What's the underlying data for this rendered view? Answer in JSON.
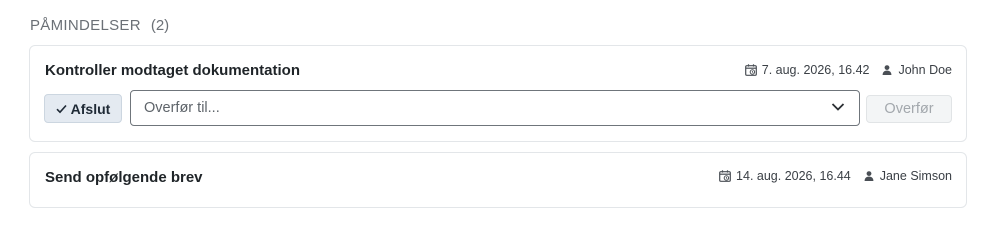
{
  "section": {
    "title": "PÅMINDELSER",
    "count": "(2)"
  },
  "reminders": [
    {
      "title": "Kontroller modtaget dokumentation",
      "datetime": "7. aug. 2026, 16.42",
      "user": "John Doe",
      "complete_label": "Afslut",
      "transfer_placeholder": "Overfør til...",
      "transfer_label": "Overfør"
    },
    {
      "title": "Send opfølgende brev",
      "datetime": "14. aug. 2026, 16.44",
      "user": "Jane Simson"
    }
  ],
  "icons": {
    "date": "calendar-clock-icon",
    "user": "person-icon",
    "check": "check-icon",
    "chevron": "chevron-down-icon"
  },
  "colors": {
    "complete_bg": "#e4eaf1",
    "transfer_text": "#a3a8ad",
    "border": "#e3e6e9"
  }
}
